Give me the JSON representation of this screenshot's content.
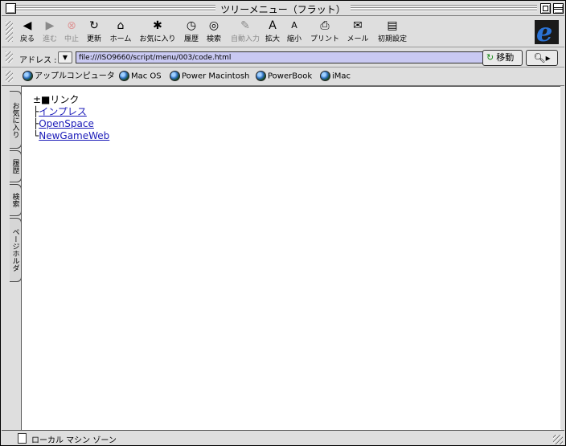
{
  "window": {
    "title": "ツリーメニュー（フラット）"
  },
  "toolbar": {
    "buttons": [
      {
        "label": "戻る",
        "icon": "back-arrow-icon",
        "enabled": true
      },
      {
        "label": "進む",
        "icon": "forward-arrow-icon",
        "enabled": false
      },
      {
        "label": "中止",
        "icon": "stop-icon",
        "enabled": false
      },
      {
        "label": "更新",
        "icon": "refresh-icon",
        "enabled": true
      },
      {
        "label": "ホーム",
        "icon": "home-icon",
        "enabled": true
      },
      {
        "label": "お気に入り",
        "icon": "favorites-icon",
        "enabled": true
      },
      {
        "label": "履歴",
        "icon": "history-icon",
        "enabled": true
      },
      {
        "label": "検索",
        "icon": "search-icon",
        "enabled": true
      },
      {
        "label": "自動入力",
        "icon": "autofill-icon",
        "enabled": false
      },
      {
        "label": "拡大",
        "icon": "text-larger-icon",
        "enabled": true
      },
      {
        "label": "縮小",
        "icon": "text-smaller-icon",
        "enabled": true
      },
      {
        "label": "プリント",
        "icon": "print-icon",
        "enabled": true
      },
      {
        "label": "メール",
        "icon": "mail-icon",
        "enabled": true
      },
      {
        "label": "初期設定",
        "icon": "preferences-icon",
        "enabled": true
      }
    ]
  },
  "address": {
    "label": "アドレス :",
    "url": "file:///ISO9660/script/menu/003/code.html",
    "go_label": "移動"
  },
  "favorites_bar": {
    "items": [
      "アップルコンピュータ",
      "Mac OS",
      "Power Macintosh",
      "PowerBook",
      "iMac"
    ]
  },
  "side_tabs": [
    "お気に入り",
    "履歴",
    "検索",
    "ページホルダ"
  ],
  "content": {
    "tree": {
      "root": "±■リンク",
      "items": [
        {
          "prefix": "├",
          "label": "インプレス"
        },
        {
          "prefix": "├",
          "label": "OpenSpace"
        },
        {
          "prefix": "└",
          "label": "NewGameWeb"
        }
      ]
    }
  },
  "status": {
    "text": "ローカル マシン ゾーン"
  },
  "colors": {
    "address_field": "#c9c9f2",
    "link": "#1a1ab8",
    "chrome": "#dedede"
  }
}
